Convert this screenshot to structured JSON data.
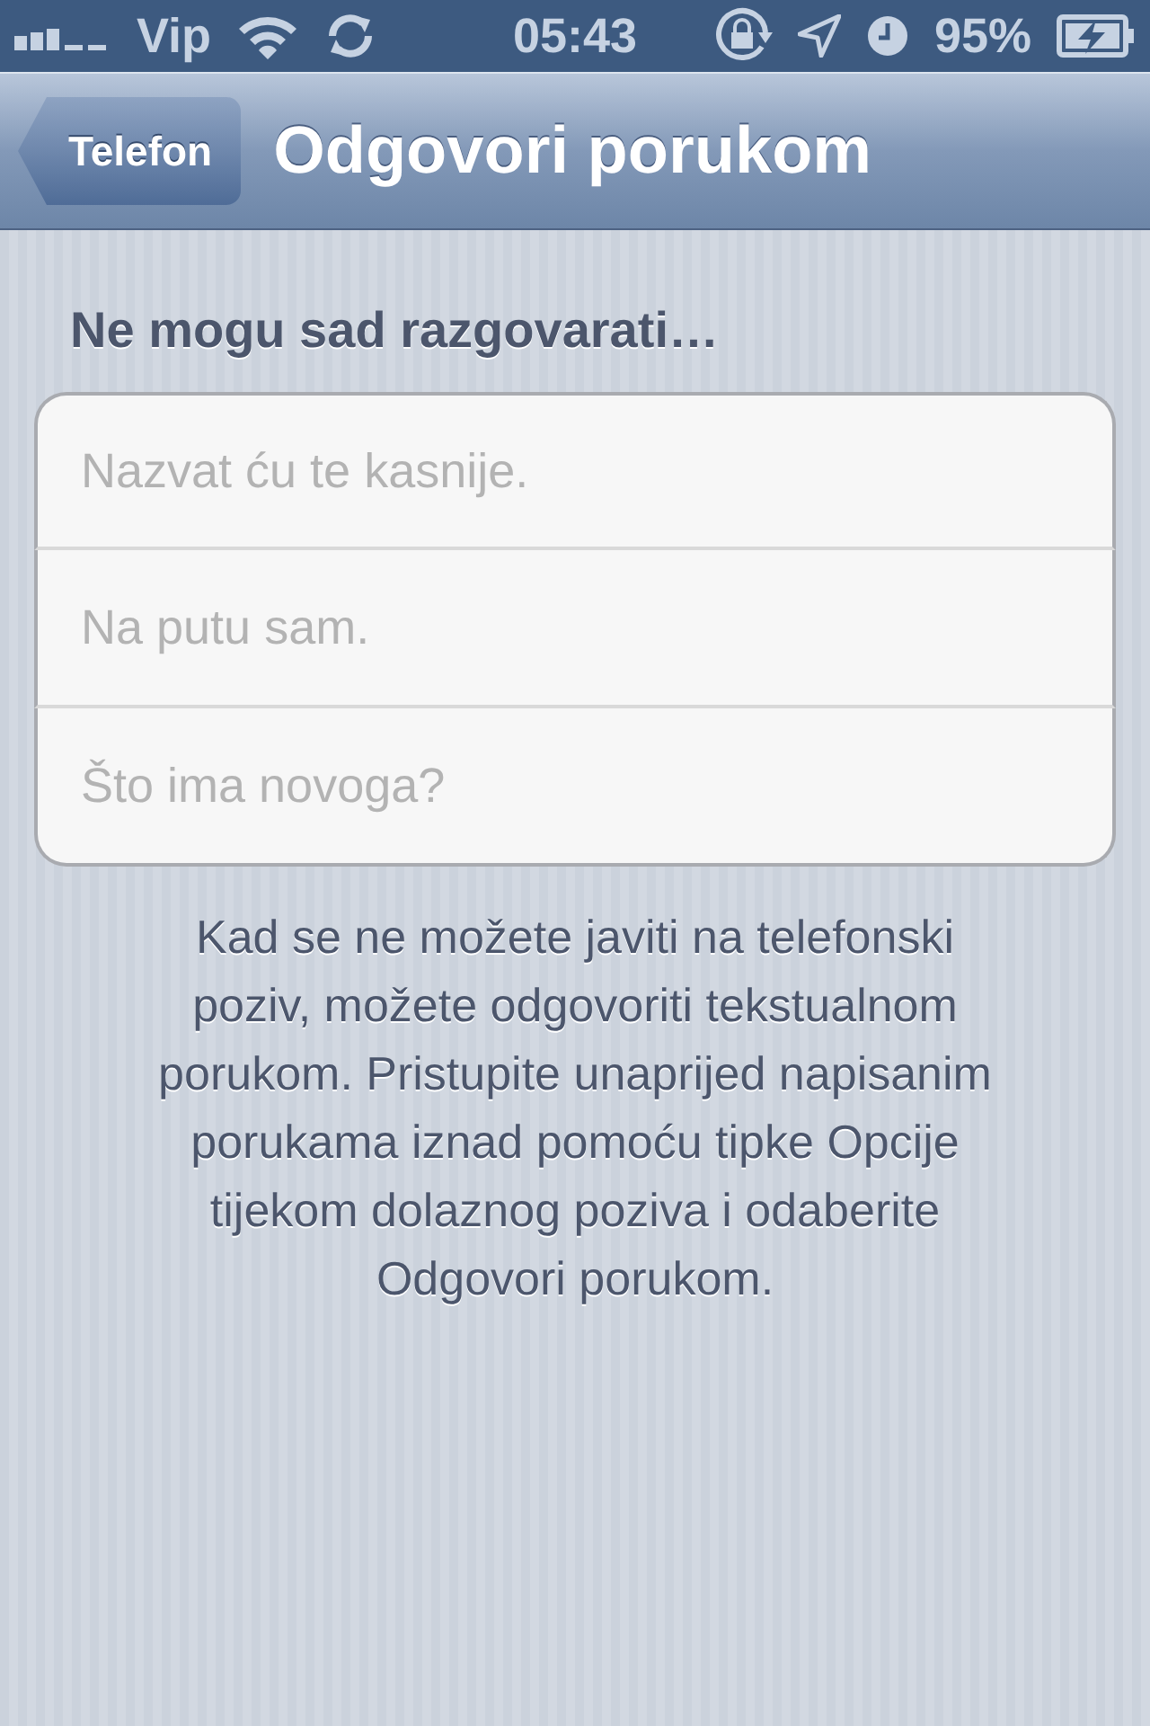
{
  "status_bar": {
    "carrier": "Vip",
    "time": "05:43",
    "battery": "95%"
  },
  "nav_bar": {
    "back": "Telefon",
    "title": "Odgovori porukom"
  },
  "section": {
    "header": "Ne mogu sad razgovarati…",
    "fields": [
      {
        "placeholder": "Nazvat ću te kasnije."
      },
      {
        "placeholder": "Na putu sam."
      },
      {
        "placeholder": "Što ima novoga?"
      }
    ],
    "footer": "Kad se ne možete javiti na telefonski poziv, možete odgovoriti tekstualnom porukom. Pristupite unaprijed napisanim porukama iznad pomoću tipke Opcije tijekom dolaznog poziva i odaberite Odgovori porukom."
  }
}
